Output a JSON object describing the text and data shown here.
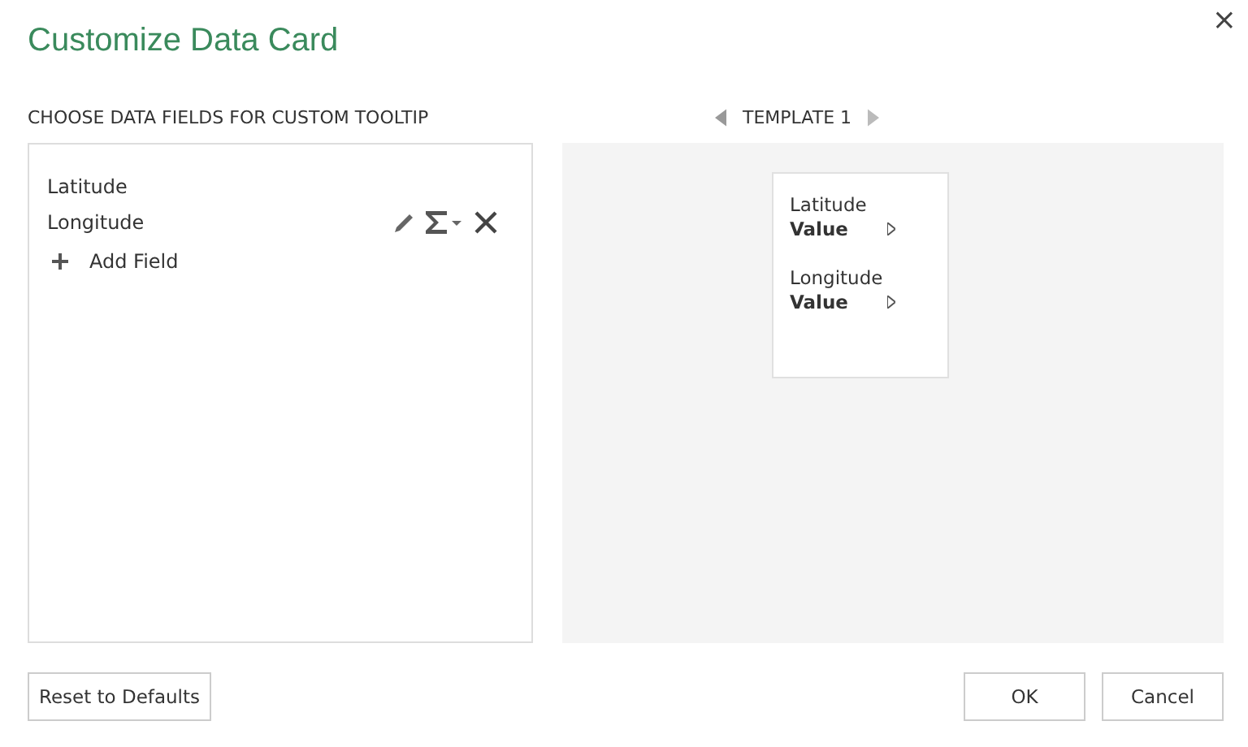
{
  "dialog": {
    "title": "Customize Data Card",
    "close": "×"
  },
  "fields_section": {
    "heading": "CHOOSE DATA FIELDS FOR CUSTOM TOOLTIP",
    "fields": [
      {
        "name": "Latitude",
        "actions_visible": false
      },
      {
        "name": "Longitude",
        "actions_visible": true
      }
    ],
    "add_field": "Add Field"
  },
  "template": {
    "label": "TEMPLATE 1",
    "card_fields": [
      {
        "label": "Latitude",
        "value": "Value"
      },
      {
        "label": "Longitude",
        "value": "Value"
      }
    ]
  },
  "buttons": {
    "reset": "Reset to Defaults",
    "ok": "OK",
    "cancel": "Cancel"
  }
}
